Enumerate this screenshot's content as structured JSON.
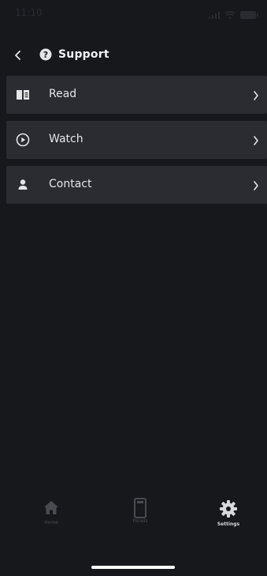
{
  "status_bar": {
    "time": "11:10",
    "icons": [
      "signal-icon",
      "wifi-icon",
      "battery-icon"
    ]
  },
  "header": {
    "back_icon": "chevron-left-icon",
    "help_icon": "question-circle-icon",
    "title": "Support"
  },
  "menu": {
    "items": [
      {
        "label": "Read",
        "icon": "book-icon"
      },
      {
        "label": "Watch",
        "icon": "play-circle-icon"
      },
      {
        "label": "Contact",
        "icon": "person-icon"
      }
    ]
  },
  "tabbar": {
    "tabs": [
      {
        "label": "Home",
        "icon": "home-icon",
        "active": false
      },
      {
        "label": "Panels",
        "icon": "panel-icon",
        "active": false
      },
      {
        "label": "Settings",
        "icon": "gear-icon",
        "active": true
      }
    ]
  },
  "colors": {
    "background": "#17181c",
    "row_background": "#2b2c31",
    "text": "#e5e5e8",
    "inactive_tab": "#4a4b50",
    "active_tab": "#d8d8dc"
  }
}
